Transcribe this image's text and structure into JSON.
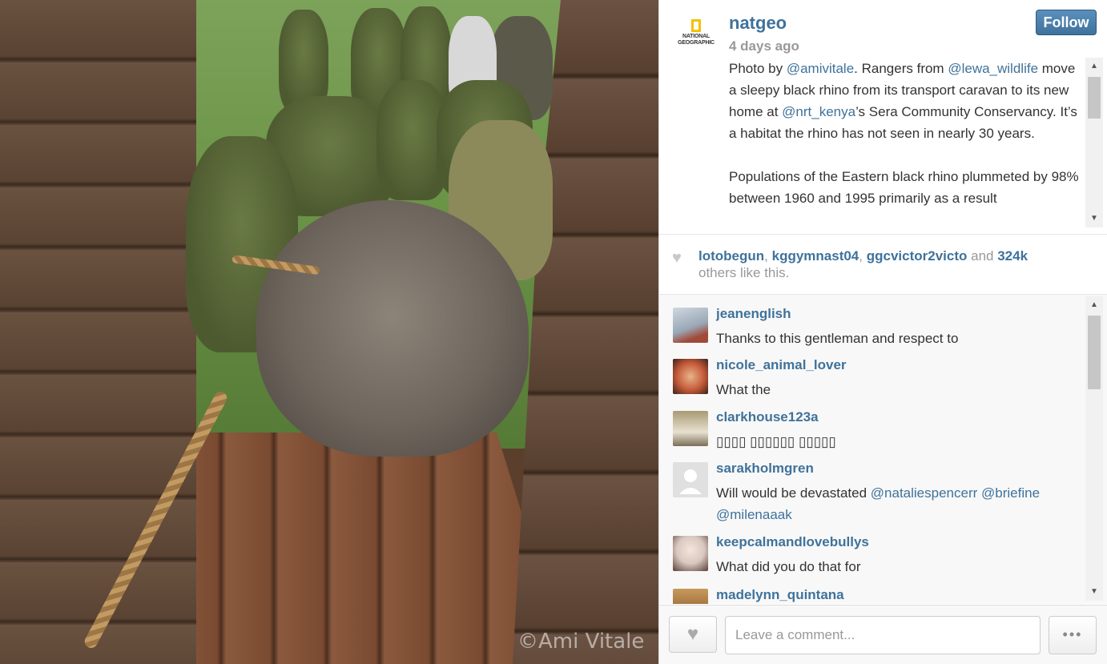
{
  "photo": {
    "credit": "©Ami Vitale"
  },
  "post": {
    "username": "natgeo",
    "time": "4 days ago",
    "follow_label": "Follow",
    "logo_text": [
      "NATIONAL",
      "GEOGRAPHIC"
    ],
    "caption": {
      "p1": {
        "pre": "Photo by ",
        "mention1": "@amivitale",
        "mid1": ". Rangers from ",
        "mention2": "@lewa_wildlife",
        "mid2": " move a sleepy black rhino from its transport caravan to its new home at ",
        "mention3": "@nrt_kenya",
        "post": "’s Sera Community Conservancy. It’s a habitat the rhino has not seen in nearly 30 years."
      },
      "p2": "Populations of the Eastern black rhino plummeted by 98% between 1960 and 1995 primarily as a result"
    }
  },
  "likes": {
    "users": [
      "lotobegun",
      "kggymnast04",
      "ggcvictor2victo"
    ],
    "sep": ", ",
    "and": " and ",
    "count": "324k",
    "suffix": "others like this."
  },
  "comments": [
    {
      "user": "jeanenglish",
      "text": "Thanks to this gentleman and respect to"
    },
    {
      "user": "nicole_animal_lover",
      "text": "What the"
    },
    {
      "user": "clarkhouse123a",
      "text": "▯▯▯▯ ▯▯▯▯▯▯ ▯▯▯▯▯"
    },
    {
      "user": "sarakholmgren",
      "text_pre": "Will would be devastated ",
      "m1": "@nataliespencerr",
      "m2": "@briefine",
      "m3": "@milenaaak"
    },
    {
      "user": "keepcalmandlovebullys",
      "text": "What did you do that for"
    },
    {
      "user": "madelynn_quintana",
      "text": ""
    }
  ],
  "footer": {
    "comment_placeholder": "Leave a comment...",
    "more_label": "•••",
    "like_icon": "heart-icon"
  },
  "colors": {
    "link": "#3f729b",
    "muted": "#999999",
    "logo_yellow": "#f3c200"
  }
}
